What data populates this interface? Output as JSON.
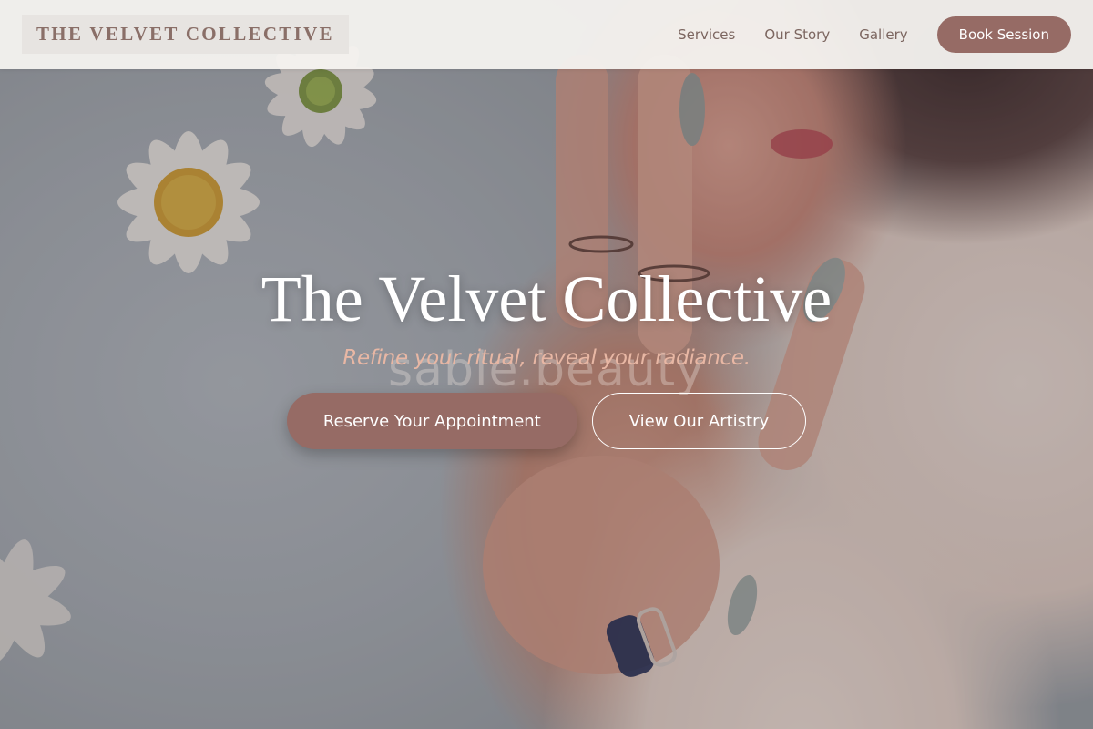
{
  "header": {
    "logo_text": "THE VELVET COLLECTIVE",
    "nav_items": [
      {
        "label": "Services"
      },
      {
        "label": "Our Story"
      },
      {
        "label": "Gallery"
      }
    ],
    "book_button_label": "Book Session"
  },
  "hero": {
    "title": "The Velvet Collective",
    "tagline": "Refine your ritual, reveal your radiance.",
    "background_watermark": "sable.beauty",
    "primary_cta_label": "Reserve Your Appointment",
    "secondary_cta_label": "View Our Artistry"
  },
  "colors": {
    "accent": "#966b65",
    "logo_text": "#8a6f68",
    "nav_text": "#7c6660",
    "tagline": "#e8b7a4",
    "header_bg": "#f6f3f0"
  }
}
